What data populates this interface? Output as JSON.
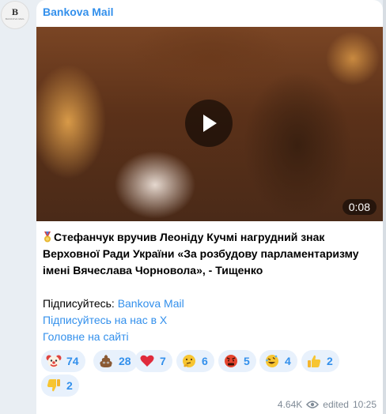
{
  "channel": {
    "name": "Bankova Mail",
    "avatar_letter": "B",
    "avatar_caption": "BANKOVA MAIL"
  },
  "video": {
    "duration": "0:08"
  },
  "post": {
    "headline": "Стефанчук вручив Леоніду Кучмі нагрудний знак Верховної Ради України «За розбудову парламентаризму імені Вячеслава Чорновола», - Тищенко",
    "subscribe_prefix": "Підписуйтесь: ",
    "subscribe_link": "Bankova Mail",
    "x_link": "Підписуйтесь на нас в Х",
    "site_link": "Головне на сайті"
  },
  "reactions": [
    {
      "icon": "clown-face-icon",
      "count": "74"
    },
    {
      "icon": "poop-icon",
      "count": "28"
    },
    {
      "icon": "red-heart-icon",
      "count": "7"
    },
    {
      "icon": "thinking-face-icon",
      "count": "6"
    },
    {
      "icon": "angry-face-icon",
      "count": "5"
    },
    {
      "icon": "rofl-face-icon",
      "count": "4"
    },
    {
      "icon": "thumbs-up-icon",
      "count": "2"
    },
    {
      "icon": "thumbs-down-icon",
      "count": "2"
    }
  ],
  "meta": {
    "views": "4.64K",
    "edited_label": "edited",
    "time": "10:25"
  },
  "colors": {
    "accent": "#3390ec",
    "reaction_bg": "#e8f1fc",
    "meta_text": "#7f8a96"
  }
}
